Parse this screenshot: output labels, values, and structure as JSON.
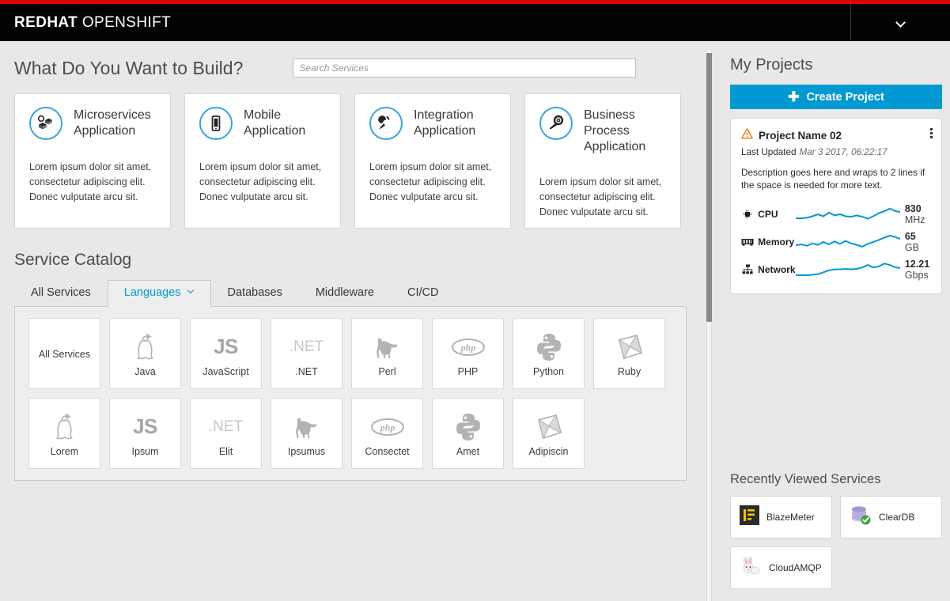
{
  "masthead": {
    "brand_bold": "REDHAT",
    "brand_light": " OPENSHIFT",
    "user_menu_icon": "chevron-down-icon"
  },
  "build": {
    "title": "What Do You Want to Build?",
    "search_placeholder": "Search Services",
    "search_value": "",
    "cards": [
      {
        "name": "Microservices Application",
        "icon": "microservices-boxes-icon",
        "description": "Lorem ipsum dolor sit amet, consectetur adipiscing elit. Donec vulputate arcu sit."
      },
      {
        "name": "Mobile Application",
        "icon": "mobile-phone-icon",
        "description": "Lorem ipsum dolor sit amet, consectetur adipiscing elit. Donec vulputate arcu sit."
      },
      {
        "name": "Integration Application",
        "icon": "power-plug-icon",
        "description": "Lorem ipsum dolor sit amet, consectetur adipiscing elit. Donec vulputate arcu sit."
      },
      {
        "name": "Business Process Application",
        "icon": "wrench-gear-icon",
        "description": "Lorem ipsum dolor sit amet, consectetur adipiscing elit. Donec vulputate arcu sit."
      }
    ]
  },
  "catalog": {
    "title": "Service Catalog",
    "tabs": [
      {
        "label": "All Services",
        "active": false,
        "has_caret": false
      },
      {
        "label": "Languages",
        "active": true,
        "has_caret": true
      },
      {
        "label": "Databases",
        "active": false,
        "has_caret": false
      },
      {
        "label": "Middleware",
        "active": false,
        "has_caret": false
      },
      {
        "label": "CI/CD",
        "active": false,
        "has_caret": false
      }
    ],
    "tiles": [
      {
        "label": "All Services",
        "logo": "none",
        "logo_text": ""
      },
      {
        "label": "Java",
        "logo": "java-duke-icon",
        "logo_text": ""
      },
      {
        "label": "JavaScript",
        "logo": "js-text",
        "logo_text": "JS"
      },
      {
        "label": ".NET",
        "logo": "dotnet-text",
        "logo_text": ".NET"
      },
      {
        "label": "Perl",
        "logo": "perl-camel-icon",
        "logo_text": ""
      },
      {
        "label": "PHP",
        "logo": "php-oval-icon",
        "logo_text": ""
      },
      {
        "label": "Python",
        "logo": "python-snakes-icon",
        "logo_text": ""
      },
      {
        "label": "Ruby",
        "logo": "ruby-gem-icon",
        "logo_text": ""
      },
      {
        "label": "Lorem",
        "logo": "java-duke-icon",
        "logo_text": ""
      },
      {
        "label": "Ipsum",
        "logo": "js-text",
        "logo_text": "JS"
      },
      {
        "label": "Elit",
        "logo": "dotnet-text",
        "logo_text": ".NET"
      },
      {
        "label": "Ipsumus",
        "logo": "perl-camel-icon",
        "logo_text": ""
      },
      {
        "label": "Consectet",
        "logo": "php-oval-icon",
        "logo_text": ""
      },
      {
        "label": "Amet",
        "logo": "python-snakes-icon",
        "logo_text": ""
      },
      {
        "label": "Adipiscin",
        "logo": "ruby-gem-icon",
        "logo_text": ""
      }
    ]
  },
  "projects": {
    "title": "My Projects",
    "create_label": "Create Project",
    "create_icon": "plus-icon",
    "card": {
      "status_icon": "warning-triangle-icon",
      "name": "Project Name 02",
      "updated_label": "Last Updated",
      "updated_value": "Mar 3 2017, 06:22:17",
      "menu_icon": "kebab-menu-icon",
      "description": "Description goes here and wraps to 2 lines if the space is needed for more text.",
      "metrics": [
        {
          "icon": "cpu-chip-icon",
          "label": "CPU",
          "value": "830",
          "unit": "MHz",
          "stacked": true
        },
        {
          "icon": "memory-stick-icon",
          "label": "Memory",
          "value": "65",
          "unit": "GB",
          "stacked": false
        },
        {
          "icon": "network-hub-icon",
          "label": "Network",
          "value": "12.21",
          "unit": "Gbps",
          "stacked": true
        }
      ]
    }
  },
  "recent": {
    "title": "Recently Viewed Services",
    "items": [
      {
        "name": "BlazeMeter",
        "icon": "blazemeter-icon"
      },
      {
        "name": "ClearDB",
        "icon": "cleardb-icon"
      },
      {
        "name": "CloudAMQP",
        "icon": "cloudamqp-rabbit-icon"
      }
    ]
  },
  "colors": {
    "brand_red": "#e00000",
    "accent_blue": "#0099d3",
    "icon_ring_blue": "#3ba5dd",
    "warning_orange": "#ec7a08",
    "page_bg": "#e8e8e8"
  },
  "chart_data": [
    {
      "type": "line",
      "title": "CPU",
      "ylabel": "MHz",
      "current_value": 830,
      "unit": "MHz",
      "x": [
        0,
        1,
        2,
        3,
        4,
        5,
        6,
        7,
        8,
        9,
        10,
        11,
        12,
        13,
        14,
        15,
        16,
        17,
        18,
        19
      ],
      "values": [
        18,
        18,
        19,
        22,
        26,
        22,
        30,
        24,
        26,
        22,
        21,
        24,
        21,
        17,
        22,
        29,
        33,
        38,
        33,
        31
      ],
      "grid": false,
      "legend": "none"
    },
    {
      "type": "line",
      "title": "Memory",
      "ylabel": "GB",
      "current_value": 65,
      "unit": "GB",
      "x": [
        0,
        1,
        2,
        3,
        4,
        5,
        6,
        7,
        8,
        9,
        10,
        11,
        12,
        13,
        14,
        15,
        16,
        17,
        18,
        19
      ],
      "values": [
        20,
        22,
        19,
        24,
        21,
        27,
        22,
        29,
        24,
        30,
        25,
        22,
        18,
        23,
        27,
        31,
        36,
        40,
        37,
        33
      ],
      "grid": false,
      "legend": "none"
    },
    {
      "type": "line",
      "title": "Network",
      "ylabel": "Gbps",
      "current_value": 12.21,
      "unit": "Gbps",
      "x": [
        0,
        1,
        2,
        3,
        4,
        5,
        6,
        7,
        8,
        9,
        10,
        11,
        12,
        13,
        14,
        15,
        16,
        17,
        18,
        19
      ],
      "values": [
        12,
        12,
        12,
        13,
        14,
        18,
        22,
        24,
        24,
        25,
        24,
        25,
        28,
        33,
        28,
        30,
        36,
        33,
        28,
        27
      ],
      "grid": false,
      "legend": "none"
    }
  ]
}
